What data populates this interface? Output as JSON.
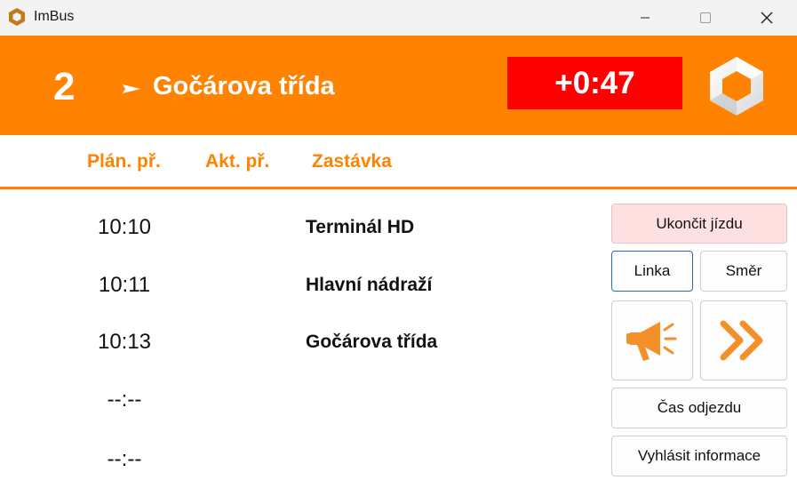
{
  "window": {
    "title": "ImBus",
    "minimize_glyph": "—",
    "close_glyph": "✕"
  },
  "header": {
    "route_number": "2",
    "direction_arrow": "►",
    "destination": "Gočárova třída",
    "delay": "+0:47",
    "delay_color": "#ff0000",
    "band_color": "#ff8200"
  },
  "columns": {
    "planned": "Plán. př.",
    "actual": "Akt. př.",
    "stop": "Zastávka"
  },
  "rows": [
    {
      "planned": "10:10",
      "actual": "",
      "stop": "Terminál HD"
    },
    {
      "planned": "10:11",
      "actual": "",
      "stop": "Hlavní nádraží"
    },
    {
      "planned": "10:13",
      "actual": "",
      "stop": "Gočárova třída"
    },
    {
      "planned": "--:--",
      "actual": "",
      "stop": ""
    },
    {
      "planned": "--:--",
      "actual": "",
      "stop": ""
    }
  ],
  "buttons": {
    "end_trip": "Ukončit jízdu",
    "line": "Linka",
    "direction": "Směr",
    "announce_icon": "megaphone-icon",
    "skip_icon": "double-chevron-right-icon",
    "departure_time": "Čas odjezdu",
    "announce_info": "Vyhlásit informace"
  }
}
